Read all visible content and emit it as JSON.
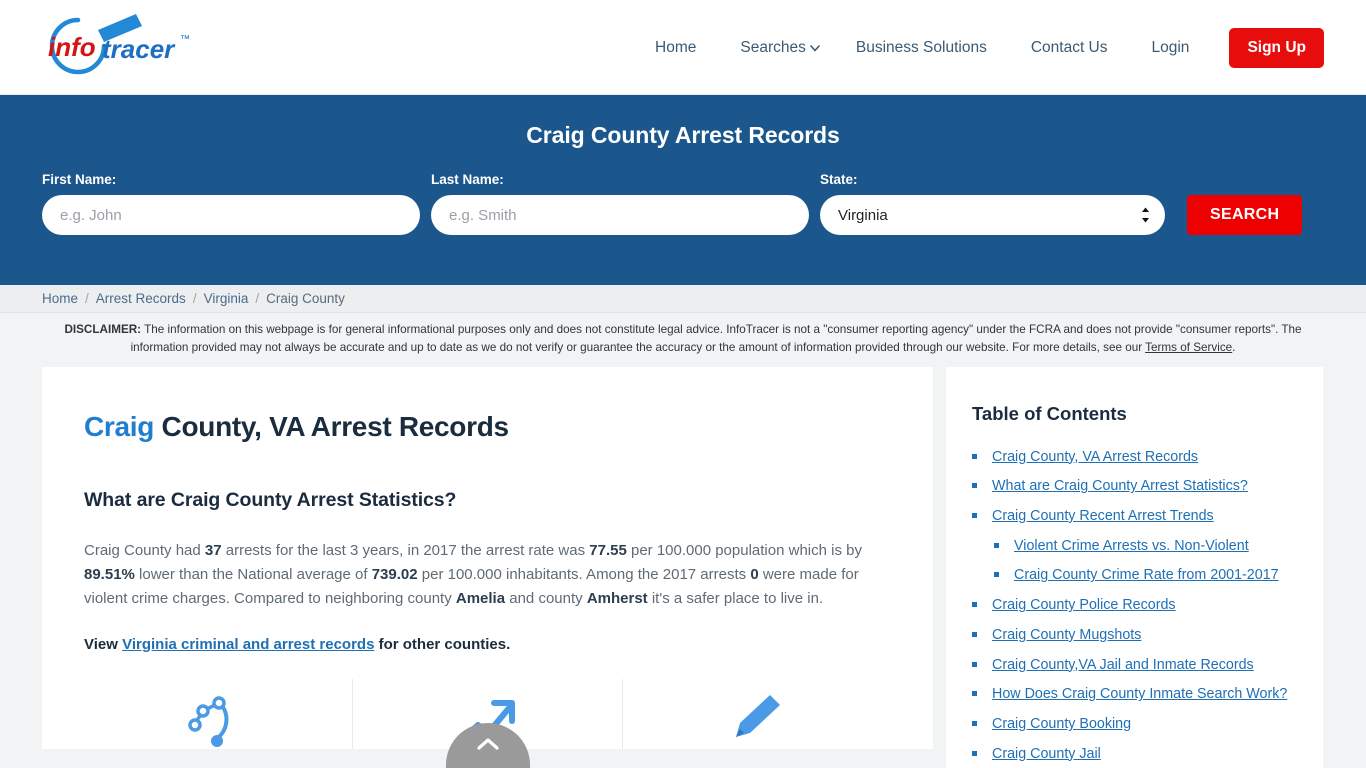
{
  "header": {
    "logo_text": "infotracer",
    "logo_tm": "™",
    "nav": [
      {
        "label": "Home",
        "icon": null
      },
      {
        "label": "Searches",
        "icon": "chevron-down-icon"
      },
      {
        "label": "Business Solutions",
        "icon": null
      },
      {
        "label": "Contact Us",
        "icon": null
      },
      {
        "label": "Login",
        "icon": null
      }
    ],
    "signup_label": "Sign Up"
  },
  "banner": {
    "title": "Craig County Arrest Records",
    "first_name_label": "First Name:",
    "first_name_placeholder": "e.g. John",
    "first_name_value": "",
    "last_name_label": "Last Name:",
    "last_name_placeholder": "e.g. Smith",
    "last_name_value": "",
    "state_label": "State:",
    "state_value": "Virginia",
    "search_label": "SEARCH",
    "accent_blue": "#1b578c",
    "accent_red": "#ee0000"
  },
  "breadcrumb": [
    {
      "label": "Home",
      "current": false
    },
    {
      "label": "Arrest Records",
      "current": false
    },
    {
      "label": "Virginia",
      "current": false
    },
    {
      "label": "Craig County",
      "current": true
    }
  ],
  "breadcrumb_separator": "/",
  "disclaimer": {
    "label": "DISCLAIMER:",
    "text": " The information on this webpage is for general informational purposes only and does not constitute legal advice. InfoTracer is not a \"consumer reporting agency\" under the FCRA and does not provide \"consumer reports\". The information provided may not always be accurate and up to date as we do not verify or guarantee the accuracy or the amount of information provided through our website. For more details, see our ",
    "link_label": "Terms of Service",
    "period": "."
  },
  "main": {
    "title_accent": "Craig",
    "title_rest": " County, VA Arrest Records",
    "sub_head": "What are Craig County Arrest Statistics?",
    "paragraph": {
      "p1": "Craig County had ",
      "b1": "37",
      "p2": " arrests for the last 3 years, in 2017 the arrest rate was ",
      "b2": "77.55",
      "p3": " per 100.000 population which is by ",
      "b3": "89.51%",
      "p4": " lower than the National average of ",
      "b4": "739.02",
      "p5": " per 100.000 inhabitants. Among the 2017 arrests ",
      "b5": "0",
      "p6": " were made for violent crime charges. Compared to neighboring county ",
      "b6": "Amelia",
      "p7": " and county ",
      "b7": "Amherst",
      "p8": " it's a safer place to live in."
    },
    "view_prefix": "View ",
    "view_link": "Virginia criminal and arrest records",
    "view_suffix": " for other counties."
  },
  "toc": {
    "title": "Table of Contents",
    "items": [
      {
        "label": "Craig County, VA Arrest Records",
        "sub": false
      },
      {
        "label": "What are Craig County Arrest Statistics?",
        "sub": false
      },
      {
        "label": "Craig County Recent Arrest Trends",
        "sub": false
      },
      {
        "label": "Violent Crime Arrests vs. Non-Violent",
        "sub": true
      },
      {
        "label": "Craig County Crime Rate from 2001-2017",
        "sub": true
      },
      {
        "label": "Craig County Police Records",
        "sub": false
      },
      {
        "label": "Craig County Mugshots",
        "sub": false
      },
      {
        "label": "Craig County,VA Jail and Inmate Records",
        "sub": false
      },
      {
        "label": "How Does Craig County Inmate Search Work?",
        "sub": false
      },
      {
        "label": "Craig County Booking",
        "sub": false
      },
      {
        "label": "Craig County Jail",
        "sub": false
      }
    ]
  },
  "scroll_top": {
    "icon": "chevron-up-icon"
  }
}
